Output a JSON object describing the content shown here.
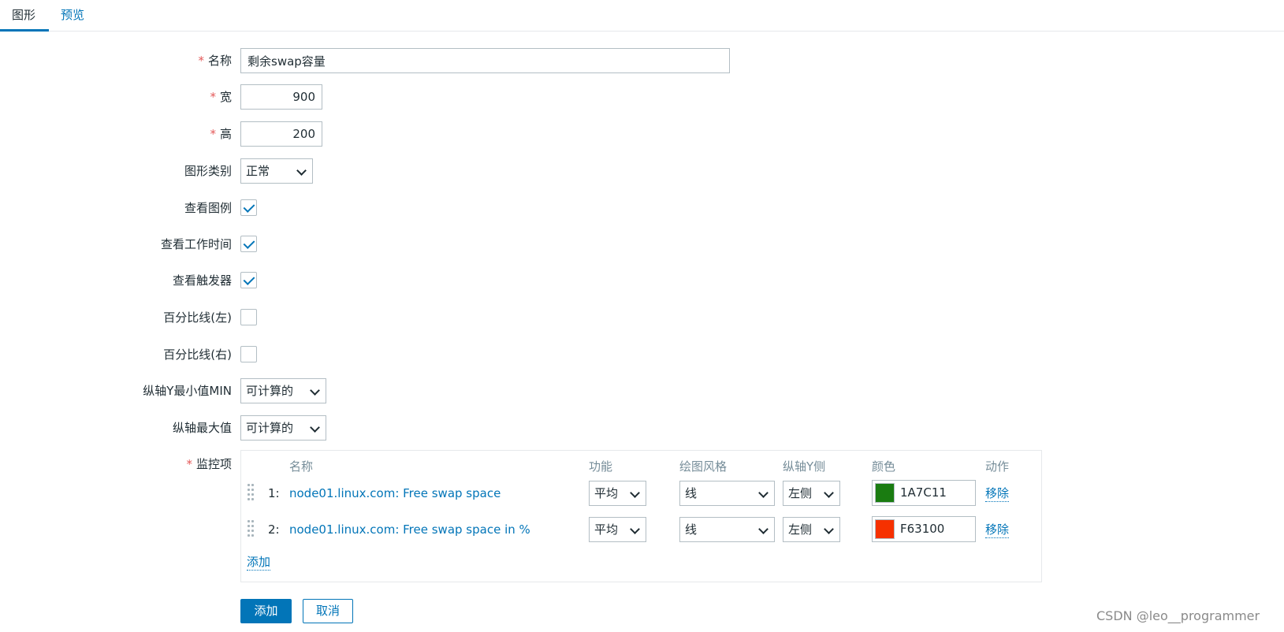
{
  "tabs": [
    {
      "label": "图形"
    },
    {
      "label": "预览"
    }
  ],
  "form": {
    "required_mark": "*",
    "name": {
      "label": "名称",
      "value": "剩余swap容量"
    },
    "width": {
      "label": "宽",
      "value": "900"
    },
    "height": {
      "label": "高",
      "value": "200"
    },
    "graph_type": {
      "label": "图形类别",
      "value": "正常"
    },
    "show_legend": {
      "label": "查看图例",
      "checked": true
    },
    "show_working_time": {
      "label": "查看工作时间",
      "checked": true
    },
    "show_triggers": {
      "label": "查看触发器",
      "checked": true
    },
    "percentile_left": {
      "label": "百分比线(左)",
      "checked": false
    },
    "percentile_right": {
      "label": "百分比线(右)",
      "checked": false
    },
    "y_min": {
      "label": "纵轴Y最小值MIN",
      "value": "可计算的"
    },
    "y_max": {
      "label": "纵轴最大值",
      "value": "可计算的"
    },
    "items": {
      "label": "监控项",
      "columns": {
        "name": "名称",
        "function": "功能",
        "draw_style": "绘图风格",
        "y_axis_side": "纵轴Y侧",
        "color": "颜色",
        "action": "动作"
      },
      "rows": [
        {
          "num": "1:",
          "name": "node01.linux.com: Free swap space",
          "function": "平均",
          "draw_style": "线",
          "y_axis_side": "左侧",
          "color": "1A7C11",
          "action": "移除"
        },
        {
          "num": "2:",
          "name": "node01.linux.com: Free swap space in %",
          "function": "平均",
          "draw_style": "线",
          "y_axis_side": "左侧",
          "color": "F63100",
          "action": "移除"
        }
      ],
      "add_label": "添加"
    }
  },
  "buttons": {
    "add": "添加",
    "cancel": "取消"
  },
  "watermark": "CSDN @leo__programmer",
  "colors": {
    "accent": "#0275b8",
    "required": "#e45959",
    "series1": "#1A7C11",
    "series2": "#F63100"
  }
}
